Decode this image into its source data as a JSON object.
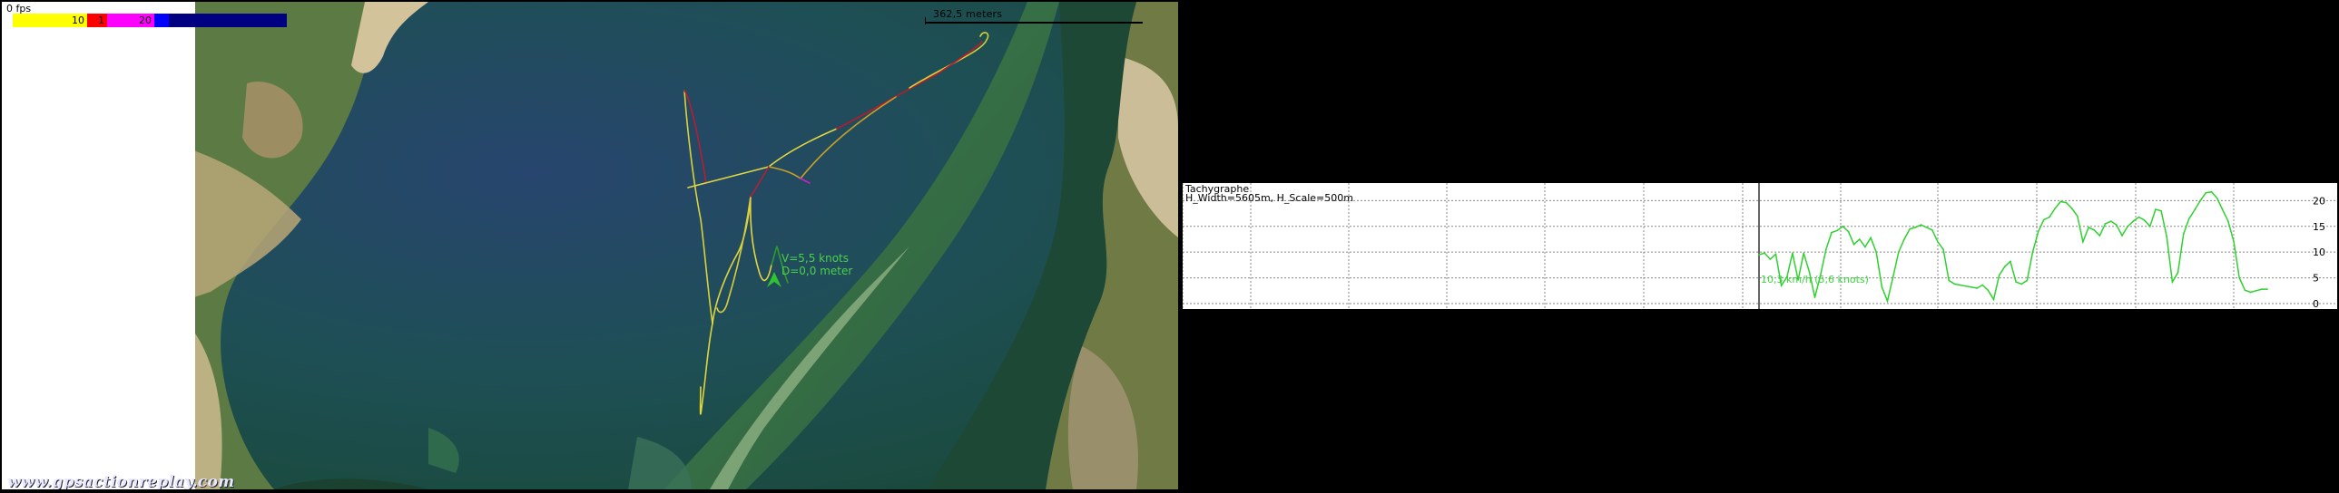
{
  "map": {
    "fps_label": "0 fps",
    "color_scale": [
      {
        "color": "#ffff00",
        "label": "10"
      },
      {
        "color": "#ff0000",
        "label": "1"
      },
      {
        "color": "#ff00ff",
        "label": "20"
      },
      {
        "color": "#0000ff",
        "label": ""
      },
      {
        "color": "#000080",
        "label": ""
      }
    ],
    "scale_label": "362,5 meters",
    "speed_line": "V=5,5 knots",
    "distance_line": "D=0,0 meter",
    "watermark": "www.gpsactionreplay.com",
    "track_colors": {
      "slow": "#e0d838",
      "mid": "#c8142a",
      "fast": "#d020c8"
    }
  },
  "chart": {
    "title": "Tachygraphe",
    "subtitle": "H_Width=5605m, H_Scale=500m",
    "cursor_readout": "10,3 km/h (5,6 knots)",
    "line_color": "#2ed12e",
    "ytick_labels": [
      "20",
      "15",
      "10",
      "5",
      "0"
    ]
  },
  "chart_data": {
    "type": "line",
    "title": "Tachygraphe",
    "subtitle": "H_Width=5605m, H_Scale=500m",
    "xlabel": "",
    "ylabel": "",
    "ylim": [
      0,
      22
    ],
    "grid": true,
    "y_ticks": [
      0,
      5,
      10,
      15,
      20
    ],
    "series": [
      {
        "values": [
          9.5,
          9.8,
          8.6,
          9.6,
          3.5,
          5.2,
          9.8,
          4.6,
          9.8,
          6.2,
          1.2,
          5.5,
          10.5,
          13.8,
          14.2,
          15.0,
          14.0,
          11.5,
          12.5,
          11.0,
          12.8,
          10.0,
          3.2,
          0.5,
          5.2,
          10.0,
          12.5,
          14.5,
          14.8,
          15.3,
          14.8,
          14.3,
          12.0,
          10.5,
          4.5,
          3.8,
          3.6,
          3.4,
          3.2,
          3.0,
          3.6,
          2.6,
          0.8,
          5.5,
          7.2,
          8.2,
          4.2,
          3.8,
          4.5,
          10.0,
          14.0,
          16.3,
          16.8,
          18.5,
          19.8,
          19.6,
          18.5,
          17.0,
          12.0,
          14.8,
          14.3,
          13.2,
          15.5,
          16.0,
          15.3,
          13.2,
          15.0,
          16.0,
          16.8,
          16.2,
          15.0,
          18.3,
          18.0,
          13.0,
          4.2,
          6.0,
          13.5,
          16.5,
          18.2,
          20.0,
          21.5,
          21.7,
          20.5,
          18.2,
          16.0,
          12.0,
          5.0,
          2.6,
          2.2,
          2.5,
          2.8,
          2.8
        ]
      }
    ]
  }
}
